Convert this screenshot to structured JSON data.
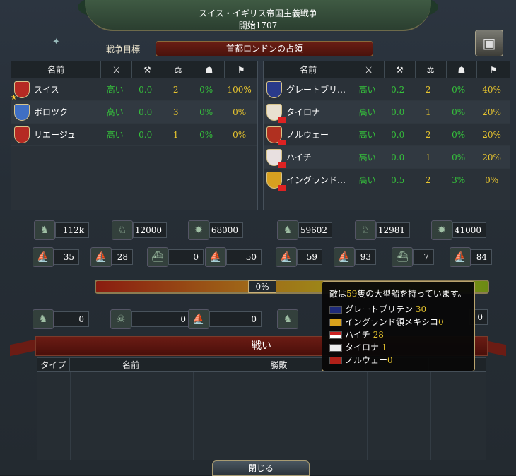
{
  "header": {
    "war_name": "スイス・イギリス帝国主義戦争",
    "started": "開始1707",
    "war_goal_label": "戦争目標",
    "war_goal": "首都ロンドンの占領"
  },
  "columns": {
    "name": "名前"
  },
  "attackers": [
    {
      "name": "スイス",
      "attitude": "高い",
      "s1": "0.0",
      "s2": "2",
      "s3": "0%",
      "s4": "100%",
      "shield": "#b52a23",
      "leader": true
    },
    {
      "name": "ボロツク",
      "attitude": "高い",
      "s1": "0.0",
      "s2": "3",
      "s3": "0%",
      "s4": "0%",
      "shield": "#3f6fc4"
    },
    {
      "name": "リエージュ",
      "attitude": "高い",
      "s1": "0.0",
      "s2": "1",
      "s3": "0%",
      "s4": "0%",
      "shield": "#b52a23"
    }
  ],
  "defenders": [
    {
      "name": "グレートブリ…",
      "attitude": "高い",
      "s1": "0.2",
      "s2": "2",
      "s3": "0%",
      "s4": "40%",
      "shield": "#2a3a8a"
    },
    {
      "name": "タイロナ",
      "attitude": "高い",
      "s1": "0.0",
      "s2": "1",
      "s3": "0%",
      "s4": "20%",
      "shield": "#e8e0d0"
    },
    {
      "name": "ノルウェー",
      "attitude": "高い",
      "s1": "0.0",
      "s2": "2",
      "s3": "0%",
      "s4": "20%",
      "shield": "#b03020"
    },
    {
      "name": "ハイチ",
      "attitude": "高い",
      "s1": "0.0",
      "s2": "1",
      "s3": "0%",
      "s4": "20%",
      "shield": "#e8e0e0"
    },
    {
      "name": "イングランド…",
      "attitude": "高い",
      "s1": "0.5",
      "s2": "2",
      "s3": "3%",
      "s4": "0%",
      "shield": "#d6a020"
    }
  ],
  "forces": {
    "attacker": {
      "infantry": "112k",
      "cavalry": "12000",
      "artillery": "68000",
      "heavy_ships": "35",
      "light_ships": "28",
      "galleys": "0",
      "transports": "50"
    },
    "defender": {
      "infantry": "59602",
      "cavalry": "12981",
      "artillery": "41000",
      "heavy_ships": "59",
      "light_ships": "93",
      "galleys": "7",
      "transports": "84"
    }
  },
  "war_score": "0%",
  "losses": {
    "land": "0",
    "attrition": "0",
    "naval": "0",
    "defender_naval": "0"
  },
  "battles": {
    "title": "戦い",
    "col_type": "タイプ",
    "col_name": "名前",
    "col_result": "勝敗"
  },
  "close_label": "閉じる",
  "tooltip": {
    "prefix": "敵は",
    "count": "59",
    "suffix": "隻の大型船を持っています。",
    "entries": [
      {
        "name": "グレートブリテン",
        "value": "30"
      },
      {
        "name": "イングランド領メキシコ",
        "value": "0"
      },
      {
        "name": "ハイチ",
        "value": "28"
      },
      {
        "name": "タイロナ",
        "value": "1"
      },
      {
        "name": "ノルウェー",
        "value": "0"
      }
    ]
  }
}
